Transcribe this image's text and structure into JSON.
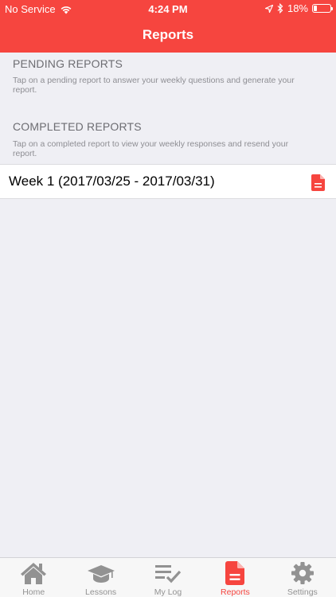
{
  "status_bar": {
    "carrier": "No Service",
    "time": "4:24 PM",
    "battery": "18%"
  },
  "nav": {
    "title": "Reports"
  },
  "pending": {
    "header": "PENDING REPORTS",
    "footer": "Tap on a pending report to answer your weekly questions and generate your report."
  },
  "completed": {
    "header": "COMPLETED REPORTS",
    "footer": "Tap on a completed report to view your weekly responses and resend your report.",
    "items": [
      {
        "label": "Week 1 (2017/03/25 - 2017/03/31)",
        "icon": "document-icon"
      }
    ]
  },
  "tabs": [
    {
      "label": "Home",
      "icon": "home-icon",
      "active": false
    },
    {
      "label": "Lessons",
      "icon": "graduation-cap-icon",
      "active": false
    },
    {
      "label": "My Log",
      "icon": "checklist-icon",
      "active": false
    },
    {
      "label": "Reports",
      "icon": "document-icon",
      "active": true
    },
    {
      "label": "Settings",
      "icon": "gear-icon",
      "active": false
    }
  ],
  "colors": {
    "accent": "#f6453f",
    "background": "#efeff4",
    "tab_inactive": "#929292"
  }
}
